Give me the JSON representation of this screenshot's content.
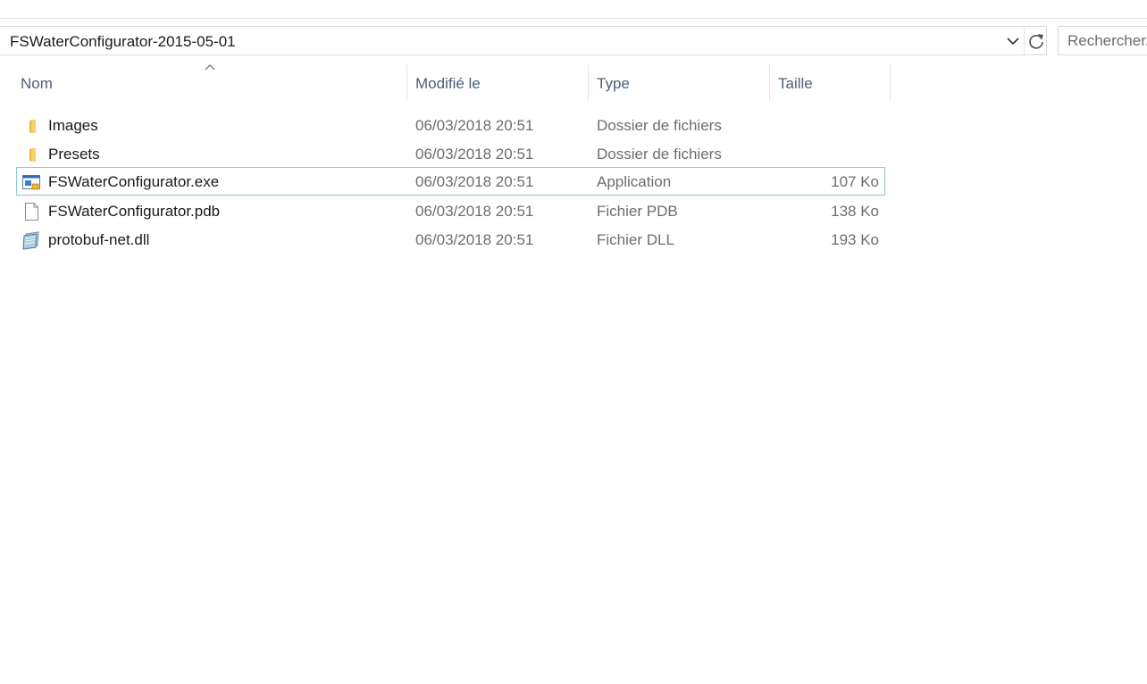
{
  "address_bar": {
    "path": "FSWaterConfigurator-2015-05-01"
  },
  "search": {
    "placeholder": "Rechercher..."
  },
  "columns": {
    "name": "Nom",
    "modified": "Modifié le",
    "type": "Type",
    "size": "Taille"
  },
  "sort": {
    "column": "Nom",
    "direction": "ascending"
  },
  "files": [
    {
      "name": "Images",
      "modified": "06/03/2018 20:51",
      "type": "Dossier de fichiers",
      "size": "",
      "icon": "folder-icon"
    },
    {
      "name": "Presets",
      "modified": "06/03/2018 20:51",
      "type": "Dossier de fichiers",
      "size": "",
      "icon": "folder-icon"
    },
    {
      "name": "FSWaterConfigurator.exe",
      "modified": "06/03/2018 20:51",
      "type": "Application",
      "size": "107 Ko",
      "icon": "application-icon",
      "focused": true
    },
    {
      "name": "FSWaterConfigurator.pdb",
      "modified": "06/03/2018 20:51",
      "type": "Fichier PDB",
      "size": "138 Ko",
      "icon": "blank-file-icon"
    },
    {
      "name": "protobuf-net.dll",
      "modified": "06/03/2018 20:51",
      "type": "Fichier DLL",
      "size": "193 Ko",
      "icon": "dll-file-icon"
    }
  ],
  "colors": {
    "header_text": "#4c607a",
    "secondary_text": "#6d6d6d",
    "focus_border": "#8fc6d6",
    "folder": "#f8d26a"
  }
}
